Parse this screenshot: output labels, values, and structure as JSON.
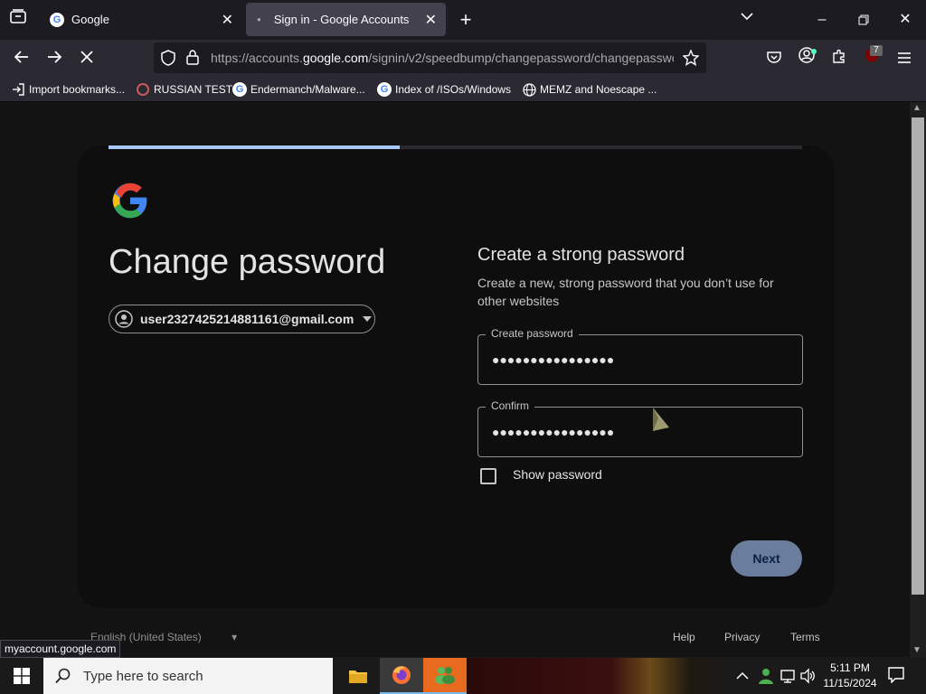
{
  "browser": {
    "tabs": [
      {
        "title": "Google",
        "active": false
      },
      {
        "title": "Sign in - Google Accounts",
        "active": true
      }
    ],
    "url_prefix": "https://accounts.",
    "url_domain": "google.com",
    "url_path": "/signin/v2/speedbump/changepassword/changepasswo",
    "extension_badge": "7",
    "bookmarks": [
      {
        "label": "Import bookmarks...",
        "icon": "import-icon"
      },
      {
        "label": "RUSSIAN TEST",
        "icon": "site-icon"
      },
      {
        "label": "Endermanch/Malware...",
        "icon": "google-icon"
      },
      {
        "label": "Index of /ISOs/Windows",
        "icon": "google-icon"
      },
      {
        "label": "MEMZ and Noescape ...",
        "icon": "globe-icon"
      }
    ],
    "status_url": "myaccount.google.com"
  },
  "page": {
    "title": "Change password",
    "account_email": "user2327425214881161@gmail.com",
    "heading": "Create a strong password",
    "description": "Create a new, strong password that you don’t use for other websites",
    "create_label": "Create password",
    "create_value": "●●●●●●●●●●●●●●●●",
    "confirm_label": "Confirm",
    "confirm_value": "●●●●●●●●●●●●●●●●",
    "show_password_label": "Show password",
    "next_label": "Next",
    "progress": 0.42,
    "footer": {
      "language": "English (United States)",
      "help": "Help",
      "privacy": "Privacy",
      "terms": "Terms"
    }
  },
  "taskbar": {
    "search_placeholder": "Type here to search",
    "time": "5:11 PM",
    "date": "11/15/2024"
  }
}
